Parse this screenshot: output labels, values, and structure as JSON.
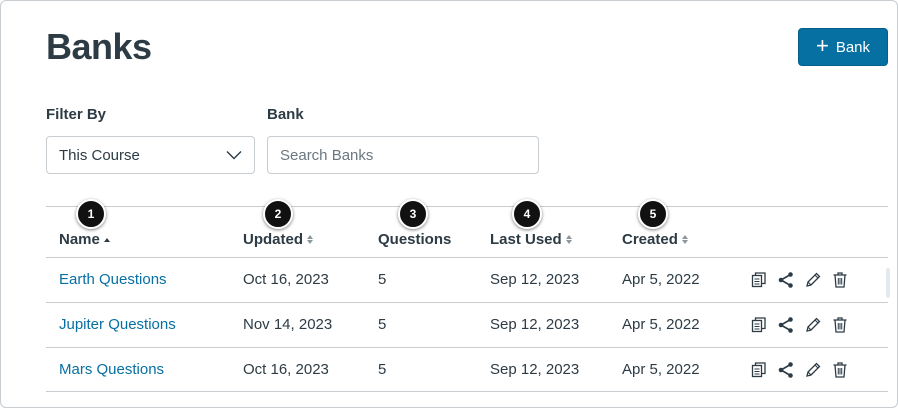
{
  "page": {
    "title": "Banks",
    "add_button_label": "Bank"
  },
  "filters": {
    "filter_by_label": "Filter By",
    "filter_by_value": "This Course",
    "bank_label": "Bank",
    "bank_placeholder": "Search Banks"
  },
  "table": {
    "columns": [
      {
        "label": "Name",
        "sort": "ascending",
        "badge": "1"
      },
      {
        "label": "Updated",
        "sort": "none",
        "badge": "2"
      },
      {
        "label": "Questions",
        "sort": null,
        "badge": "3"
      },
      {
        "label": "Last Used",
        "sort": "none",
        "badge": "4"
      },
      {
        "label": "Created",
        "sort": "none",
        "badge": "5"
      }
    ],
    "rows": [
      {
        "name": "Earth Questions",
        "updated": "Oct 16, 2023",
        "questions": "5",
        "last_used": "Sep 12, 2023",
        "created": "Apr 5, 2022"
      },
      {
        "name": "Jupiter Questions",
        "updated": "Nov 14, 2023",
        "questions": "5",
        "last_used": "Sep 12, 2023",
        "created": "Apr 5, 2022"
      },
      {
        "name": "Mars Questions",
        "updated": "Oct 16, 2023",
        "questions": "5",
        "last_used": "Sep 12, 2023",
        "created": "Apr 5, 2022"
      }
    ],
    "row_actions": [
      "copy-icon",
      "share-icon",
      "edit-pencil-icon",
      "trash-icon"
    ]
  },
  "colors": {
    "accent": "#0770a3",
    "text": "#2d3b45",
    "border": "#c7cdd1",
    "badge": "#111111"
  }
}
